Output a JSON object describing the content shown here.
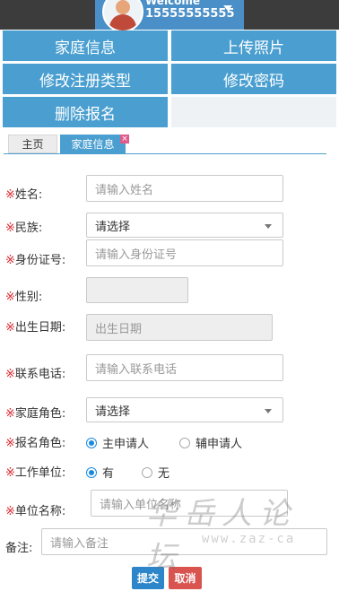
{
  "header": {
    "welcome": "Welcome",
    "phone": "15555555555"
  },
  "nav": {
    "family_info": "家庭信息",
    "upload_photo": "上传照片",
    "modify_reg_type": "修改注册类型",
    "modify_password": "修改密码",
    "delete_registration": "删除报名"
  },
  "tabs": {
    "home": "主页",
    "family_info": "家庭信息",
    "close": "×"
  },
  "form": {
    "required_mark": "※",
    "name": {
      "label": "姓名:",
      "placeholder": "请输入姓名"
    },
    "ethnicity": {
      "label": "民族:",
      "value": "请选择"
    },
    "id_number": {
      "label": "身份证号:",
      "placeholder": "请输入身份证号"
    },
    "gender": {
      "label": "性别:",
      "value": ""
    },
    "birth_date": {
      "label": "出生日期:",
      "placeholder": "出生日期"
    },
    "phone": {
      "label": "联系电话:",
      "placeholder": "请输入联系电话"
    },
    "family_role": {
      "label": "家庭角色:",
      "value": "请选择"
    },
    "apply_role": {
      "label": "报名角色:",
      "options": [
        "主申请人",
        "辅申请人"
      ],
      "selected": "主申请人"
    },
    "work_unit": {
      "label": "工作单位:",
      "options": [
        "有",
        "无"
      ],
      "selected": "有"
    },
    "unit_name": {
      "label": "单位名称:",
      "placeholder": "请输入单位名称"
    },
    "remarks": {
      "label": "备注:",
      "placeholder": "请输入备注"
    }
  },
  "buttons": {
    "submit": "提交",
    "cancel": "取消"
  },
  "watermark": {
    "text": "华岳人论坛",
    "url": "www.zaz-ca"
  },
  "colors": {
    "nav_blue": "#4a9fd0",
    "submit_blue": "#2d86c9",
    "cancel_red": "#d9534f",
    "required_red": "#d9262c"
  }
}
